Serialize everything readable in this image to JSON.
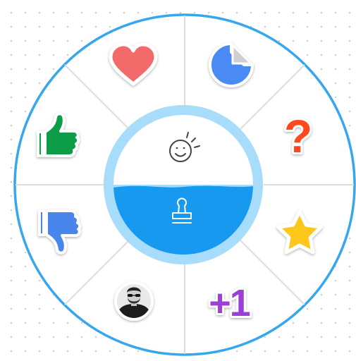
{
  "wheel": {
    "colors": {
      "outer_ring": "#36a7ee",
      "inner_ring": "#a8dcfb",
      "hub_bottom": "#1899f0",
      "divider": "#dddddd",
      "hub_top": "#ffffff"
    },
    "hub": {
      "top_icon": "smiley-icon",
      "bottom_icon": "stamp-icon"
    },
    "stickers": [
      {
        "name": "heart-sticker",
        "icon": "heart-icon",
        "color": "#f26b6b"
      },
      {
        "name": "sticky-note-sticker",
        "icon": "sticky-note-icon",
        "color": "#4a8af4"
      },
      {
        "name": "question-sticker",
        "icon": "question-mark-icon",
        "text": "?",
        "color": "#ff4a1c"
      },
      {
        "name": "star-sticker",
        "icon": "star-icon",
        "color": "#ffc61b"
      },
      {
        "name": "plus-one-sticker",
        "icon": "plus-one-icon",
        "text": "+1",
        "color": "#9b3fd6"
      },
      {
        "name": "avatar-sticker",
        "icon": "avatar-icon"
      },
      {
        "name": "thumbs-down-sticker",
        "icon": "thumbs-down-icon",
        "color": "#4a86ec"
      },
      {
        "name": "thumbs-up-sticker",
        "icon": "thumbs-up-icon",
        "color": "#0f9d4a"
      }
    ]
  }
}
